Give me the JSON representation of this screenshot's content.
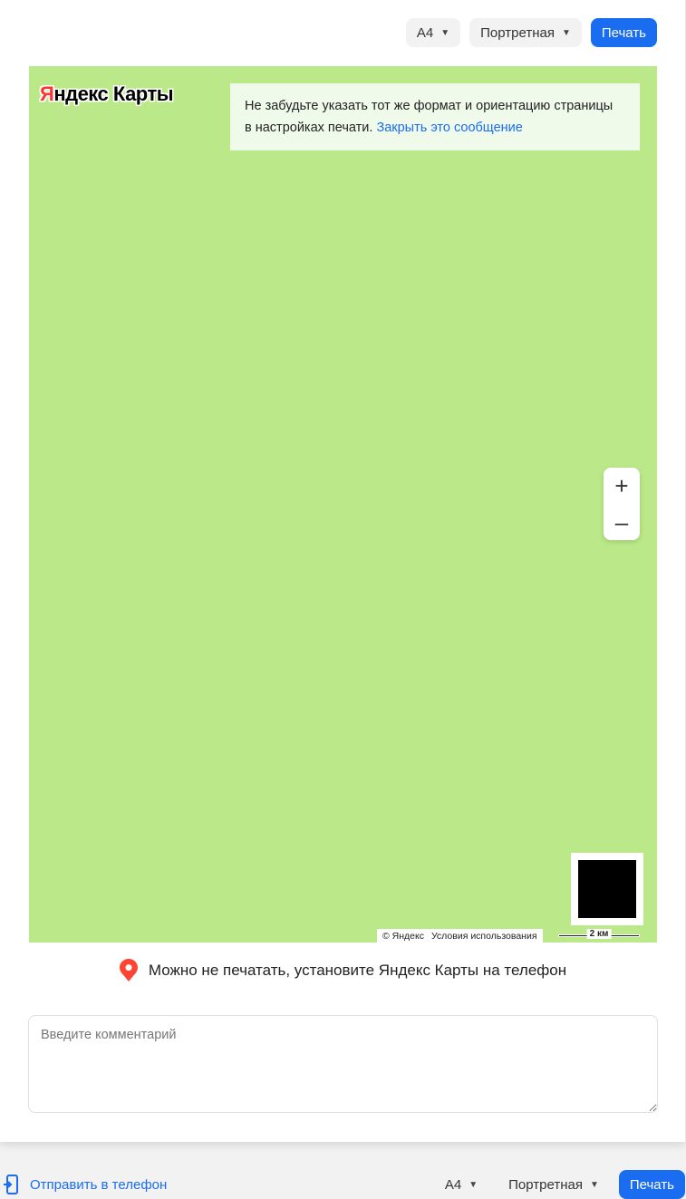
{
  "toolbar": {
    "paper_size": "A4",
    "orientation": "Портретная",
    "print_label": "Печать"
  },
  "map": {
    "logo_first_letter": "Я",
    "logo_rest": "ндекс Карты",
    "notice": {
      "text_line1": "Не забудьте указать тот же формат и ориентацию страницы",
      "text_line2": "в настройках печати.",
      "close_link": "Закрыть это сообщение"
    },
    "zoom_in": "+",
    "zoom_out": "–",
    "copyright": "© Яндекс",
    "terms": "Условия использования",
    "scale": "2 км",
    "background_color": "#bbe989"
  },
  "promo": {
    "text": "Можно не печатать, установите Яндекс Карты на телефон",
    "icon": "map-pin-icon",
    "icon_color": "#f43"
  },
  "comment": {
    "placeholder": "Введите комментарий"
  },
  "bottom_bar": {
    "send_to_phone": "Отправить в телефон",
    "paper_size": "A4",
    "orientation": "Портретная",
    "print_label": "Печать"
  },
  "colors": {
    "accent": "#1a6df0"
  }
}
